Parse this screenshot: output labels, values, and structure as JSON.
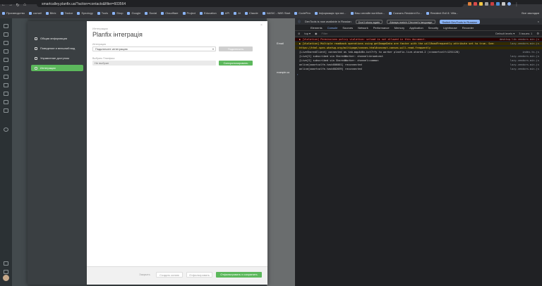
{
  "browser": {
    "url": "smartcalley.planfix.ua/?action=contacts&filter=603564",
    "bookmarks": [
      {
        "label": "Производство"
      },
      {
        "label": "usmail"
      },
      {
        "label": "Bitrix"
      },
      {
        "label": "Taskor"
      },
      {
        "label": "Synology"
      },
      {
        "label": "Tools"
      },
      {
        "label": "Shop"
      },
      {
        "label": "Google"
      },
      {
        "label": "Social"
      },
      {
        "label": "Cloudflare"
      },
      {
        "label": "Project"
      },
      {
        "label": "Education"
      },
      {
        "label": "API"
      },
      {
        "label": "AI"
      },
      {
        "label": "Claude"
      },
      {
        "label": "NASIC - NBS Start"
      },
      {
        "label": "CodePen"
      },
      {
        "label": "Інформація про вхі..."
      },
      {
        "label": "Ваш онлайн workflow..."
      },
      {
        "label": "Скачать Resident Ev..."
      },
      {
        "label": "Resident Evil 8: Villa..."
      }
    ],
    "bookmarks_right": "Все закладки"
  },
  "modal": {
    "breadcrumb": "Интеграции",
    "title": "Planfix інтеграція",
    "close": "×",
    "nav": [
      {
        "label": "Общая информация",
        "active": false
      },
      {
        "label": "Поведение и внешний вид",
        "active": false
      },
      {
        "label": "Управление доступом",
        "active": false
      },
      {
        "label": "Интеграции",
        "active": true
      }
    ],
    "field1_label": "Интеграция",
    "field1_value": "Подключите интеграцию",
    "connect_label": "Подключить",
    "field2_label": "Выбрать Планфикс",
    "field2_value": "Не выбран",
    "sync_label": "Синхронизировать",
    "footer": {
      "cancel": "Закрыть",
      "create_copy": "Создать копию",
      "archive": "Отфильтровать",
      "save": "Отфильтровать и сохранить"
    }
  },
  "background": {
    "email_header": "Email",
    "email_value": "example.ua"
  },
  "devtools": {
    "banner_text": "DevTools is now available in Russian",
    "banner_btn1": "Don't show again",
    "banner_btn2": "Always match Chrome's language",
    "banner_btn3": "Switch DevTools to Russian",
    "tabs": [
      "Elements",
      "Console",
      "Sources",
      "Network",
      "Performance",
      "Memory",
      "Application",
      "Security",
      "Lighthouse",
      "Recorder"
    ],
    "filter_top": "top ▾",
    "filter_placeholder": "Filter",
    "levels": "Default levels ▾",
    "issues": "3 issues: 1",
    "lines": [
      {
        "type": "err",
        "text": "▶ [Violation] Permissions policy violation: unload is not allowed in this document.",
        "src": "desktop-lib-vendors.min.js"
      },
      {
        "type": "warn",
        "text": "▶ [Violation] Multiple readback operations using getImageData are faster with the willReadFrequently attribute set to true. See:",
        "src": "lazy-vendors.min.js"
      },
      {
        "type": "warn",
        "text": "  https://html.spec.whatwg.org/multipage/canvas.html#concept-canvas-will-read-frequently",
        "src": ""
      },
      {
        "type": "log",
        "text": "[LiveSharedClient] connected as tab-mqp4d6v-kzt7rfy to worker planfix-live-shared-2 (v=smartcalf=1251128)",
        "src": "index-ts.js"
      },
      {
        "type": "log",
        "text": "[Live[S] subscribed via SharedWorker: channel=broadcast",
        "src": "lazy-vendors.min.js"
      },
      {
        "type": "log",
        "text": "[Live[S] subscribed via SharedWorker: channel=common",
        "src": "lazy-vendors.min.js"
      },
      {
        "type": "log",
        "text": "online[smartcalfe-task606001] reconnected",
        "src": "lazy-vendors.min.js"
      },
      {
        "type": "log",
        "text": "online[smartcalfe-task602039] reconnected",
        "src": "lazy-vendors.min.js"
      }
    ]
  },
  "colors": {
    "accent": "#5cb85c",
    "modal_nav": "#3a3f42",
    "devtools_bg": "#202124"
  }
}
